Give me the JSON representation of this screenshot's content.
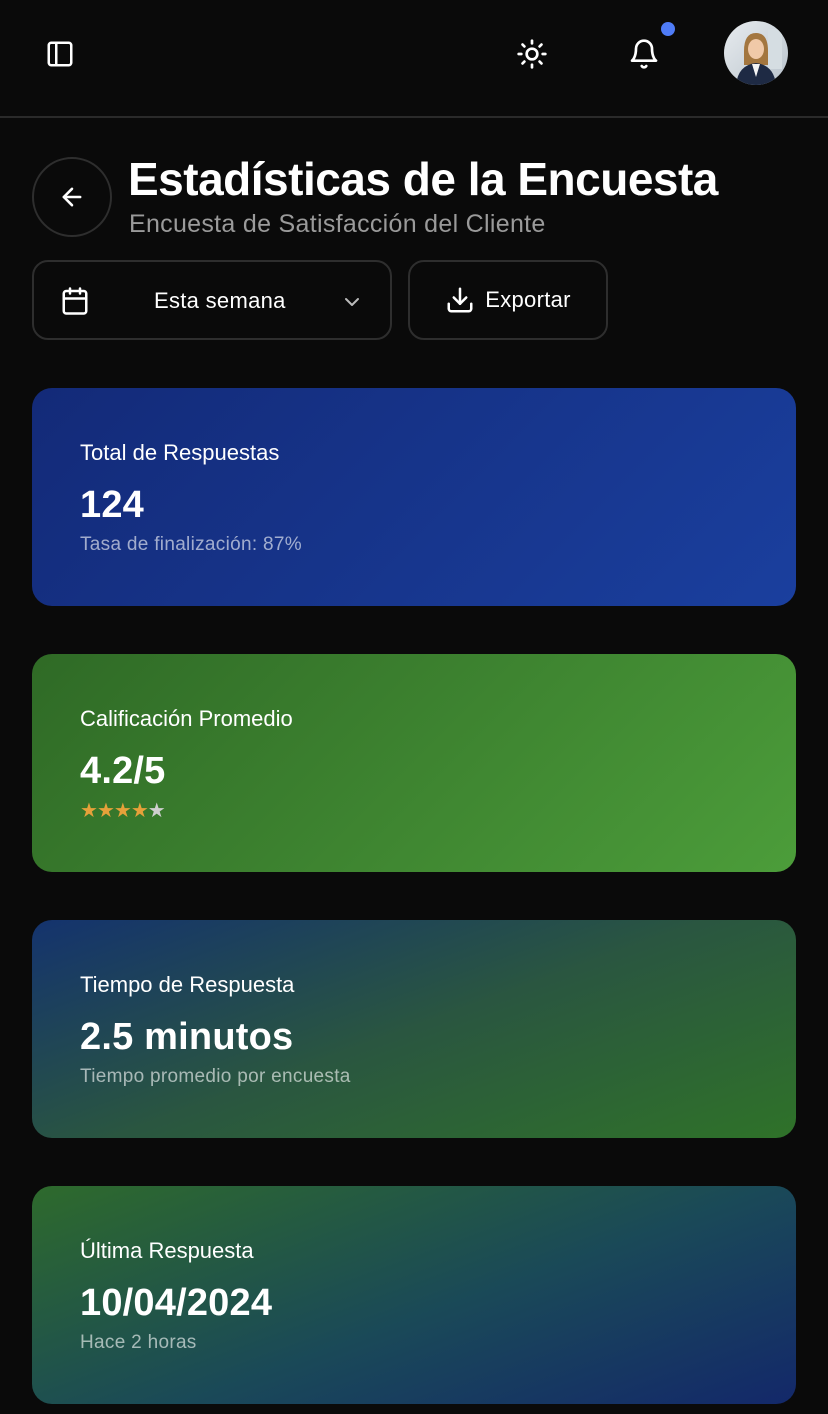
{
  "header": {
    "title": "Estadísticas de la Encuesta",
    "subtitle": "Encuesta de Satisfacción del Cliente"
  },
  "toolbar": {
    "date_filter": "Esta semana",
    "export_label": "Exportar"
  },
  "colors": {
    "background": "#0a0a0a",
    "notification_dot": "#4f7cf7",
    "star_filled": "#e6a13a"
  },
  "cards": [
    {
      "title": "Total de Respuestas",
      "value": "124",
      "subtitle": "Tasa de finalización: 87%"
    },
    {
      "title": "Calificación Promedio",
      "value": "4.2/5",
      "rating": 4,
      "rating_max": 5
    },
    {
      "title": "Tiempo de Respuesta",
      "value": "2.5 minutos",
      "subtitle": "Tiempo promedio por encuesta"
    },
    {
      "title": "Última Respuesta",
      "value": "10/04/2024",
      "subtitle": "Hace 2 horas"
    }
  ],
  "icons": [
    "sidebar-toggle-icon",
    "sun-icon",
    "bell-icon",
    "arrow-left-icon",
    "calendar-icon",
    "chevron-down-icon",
    "download-icon"
  ]
}
